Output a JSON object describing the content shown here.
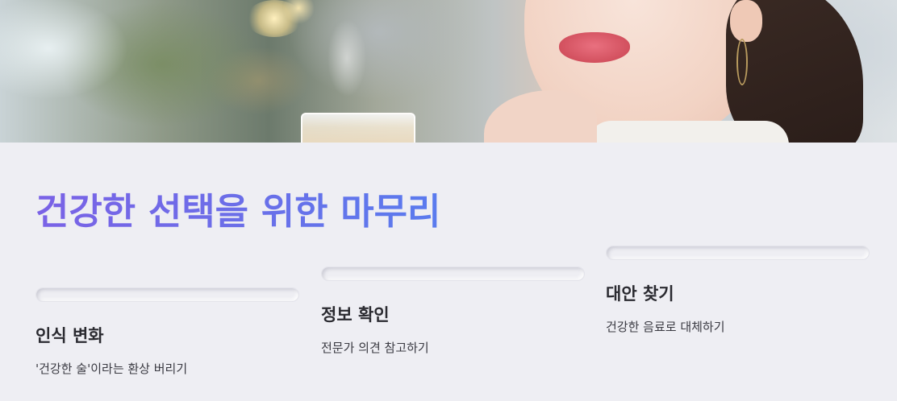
{
  "hero": {
    "image_label": "hero-photo-woman-with-hot-drink"
  },
  "section": {
    "title": "건강한 선택을 위한 마무리"
  },
  "cards": [
    {
      "title": "인식 변화",
      "description": "'건강한 술'이라는 환상 버리기"
    },
    {
      "title": "정보 확인",
      "description": "전문가 의견 참고하기"
    },
    {
      "title": "대안 찾기",
      "description": "건강한 음료로 대체하기"
    }
  ],
  "colors": {
    "background": "#eeeef3",
    "title_gradient_start": "#7a62e6",
    "title_gradient_end": "#5a7bee",
    "text": "#2a2a30"
  }
}
